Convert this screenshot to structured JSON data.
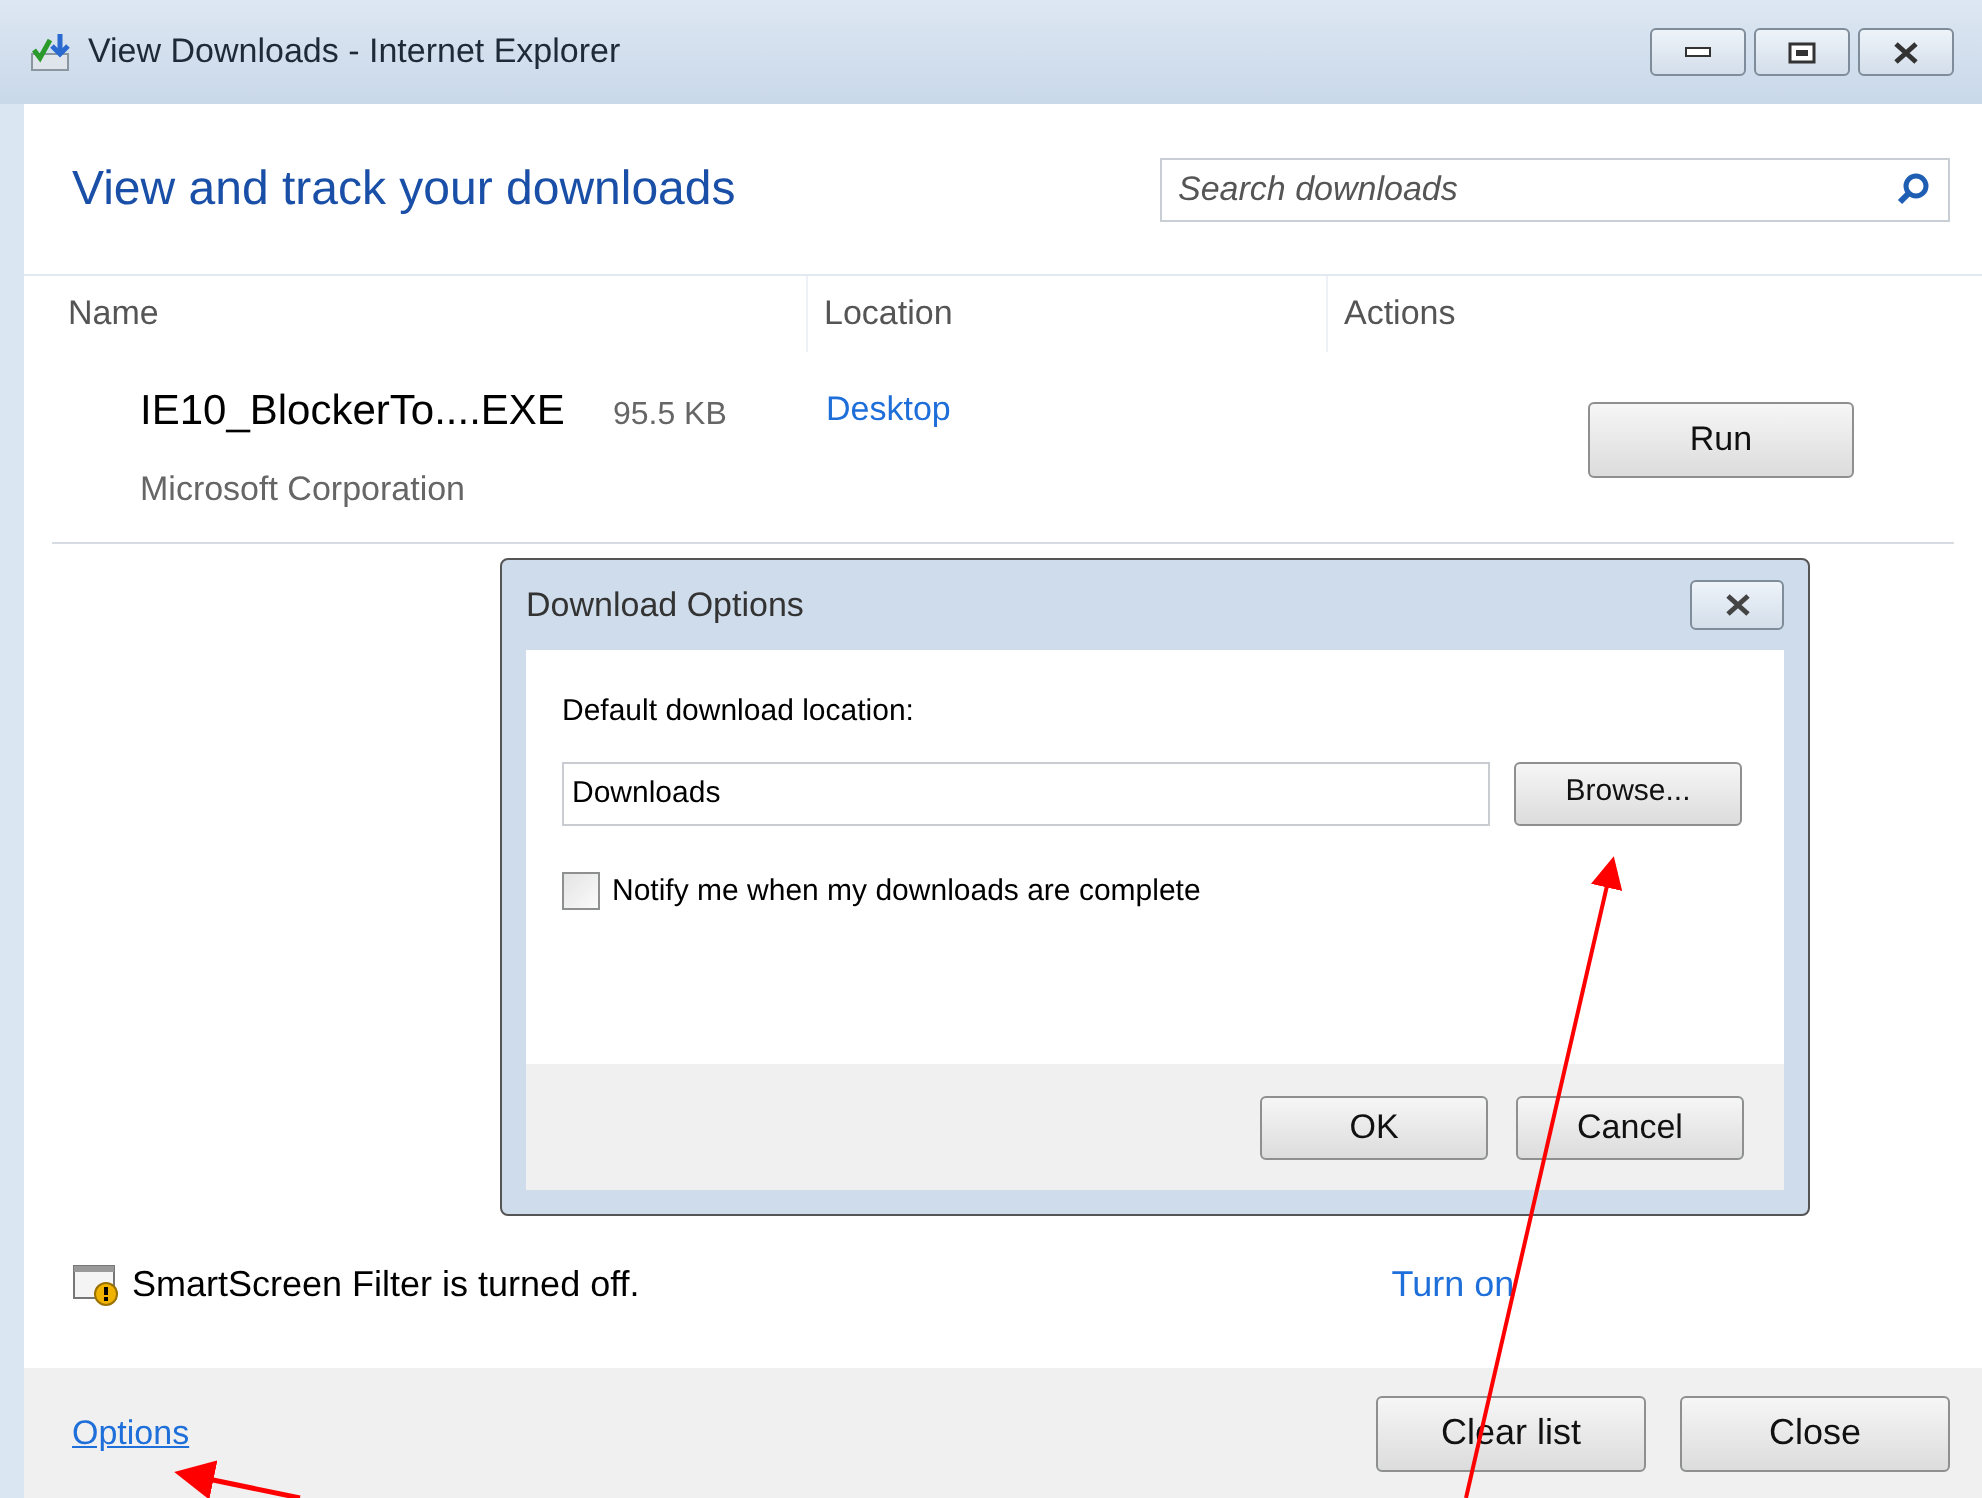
{
  "window": {
    "title": "View Downloads - Internet Explorer"
  },
  "header": {
    "title": "View and track your downloads",
    "search": {
      "placeholder": "Search downloads"
    }
  },
  "table": {
    "columns": [
      "Name",
      "Location",
      "Actions"
    ],
    "rows": [
      {
        "name": "IE10_BlockerTo....EXE",
        "size": "95.5 KB",
        "publisher": "Microsoft Corporation",
        "location": "Desktop",
        "action": "Run"
      }
    ]
  },
  "dialog": {
    "title": "Download Options",
    "location_label": "Default download location:",
    "location_value": "Downloads",
    "browse": "Browse...",
    "notify": {
      "label": "Notify me when my downloads are complete",
      "checked": false
    },
    "buttons": [
      "OK",
      "Cancel"
    ]
  },
  "smartscreen": {
    "message": "SmartScreen Filter is turned off.",
    "action": "Turn on"
  },
  "footer": {
    "link": "Options",
    "buttons": [
      "Clear list",
      "Close"
    ]
  }
}
